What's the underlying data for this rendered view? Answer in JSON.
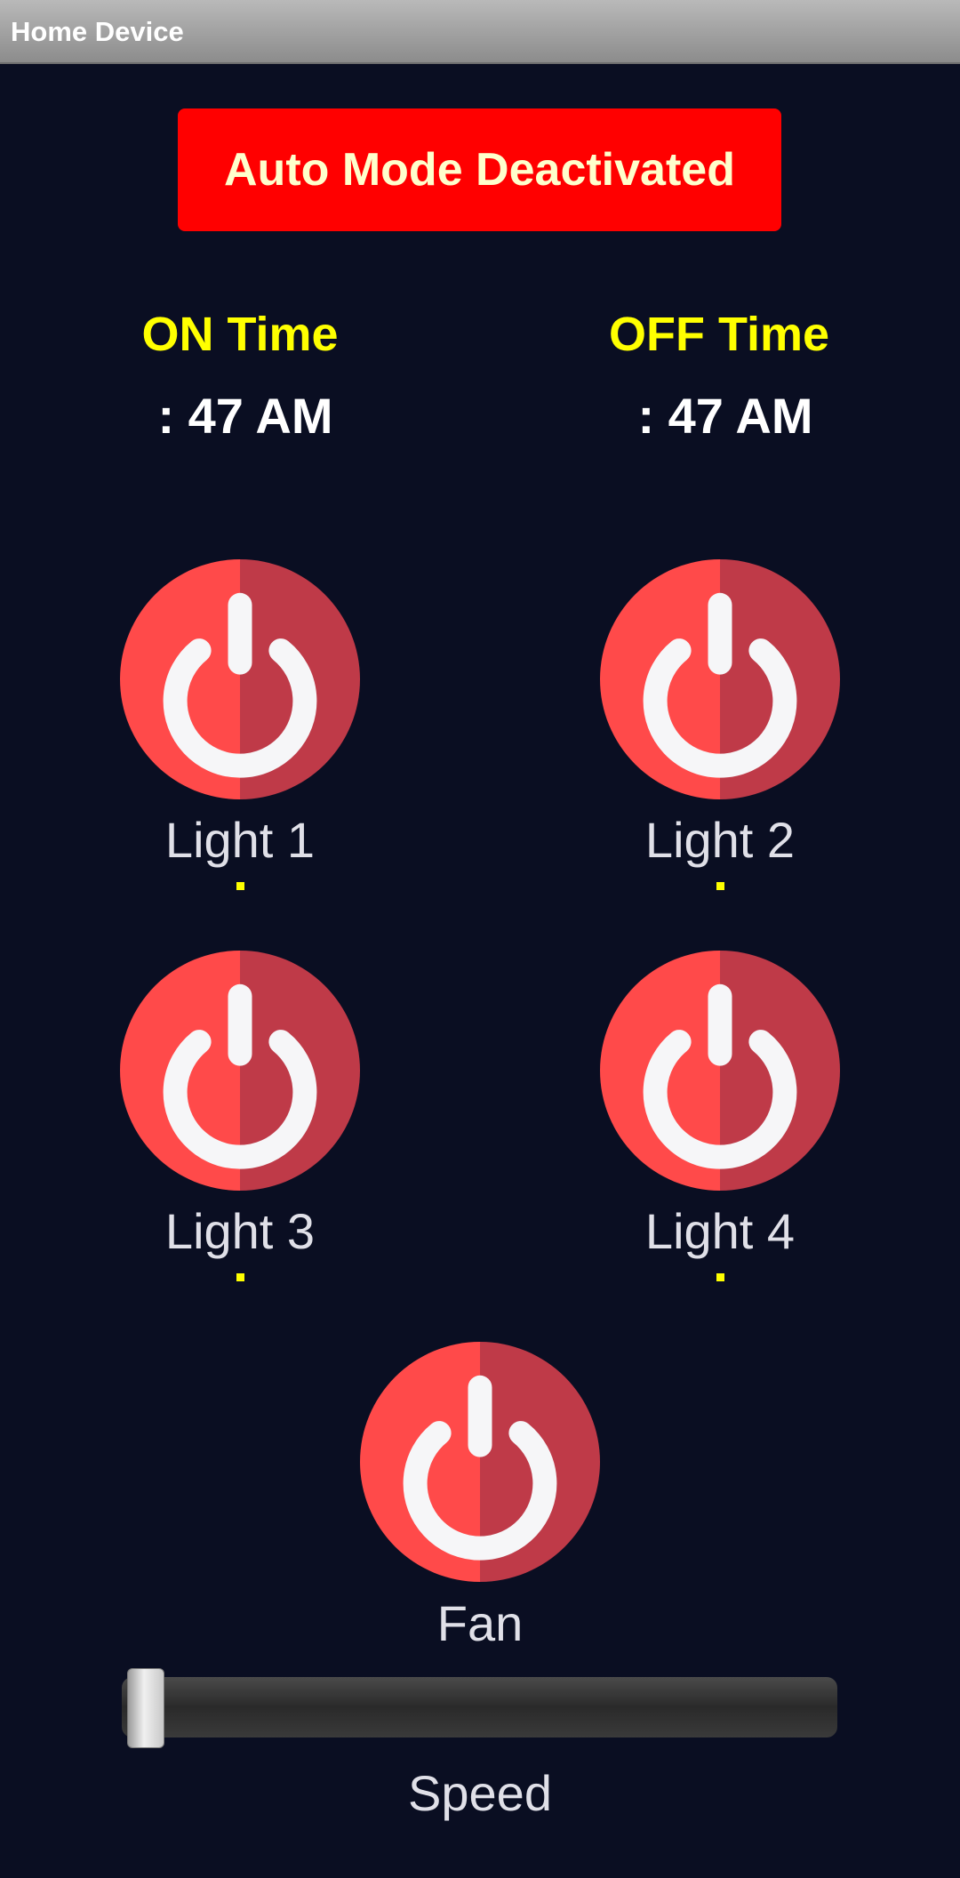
{
  "app": {
    "title": "Home Device"
  },
  "auto_mode": {
    "label": "Auto Mode Deactivated",
    "color": "#ff0000"
  },
  "schedule": {
    "on_label": "ON Time",
    "on_value": ": 47 AM",
    "off_label": "OFF Time",
    "off_value": ": 47 AM"
  },
  "devices": [
    {
      "label": "Light 1",
      "state": "off"
    },
    {
      "label": "Light 2",
      "state": "off"
    },
    {
      "label": "Light 3",
      "state": "off"
    },
    {
      "label": "Light 4",
      "state": "off"
    },
    {
      "label": "Fan",
      "state": "off"
    }
  ],
  "speed": {
    "label": "Speed",
    "value": 0
  },
  "icons": {
    "power": "power-icon"
  },
  "colors": {
    "background": "#0a0e22",
    "accent_yellow": "#ffff00",
    "power_red": "#ff4a4a",
    "power_dark_red": "#bf3a48"
  }
}
